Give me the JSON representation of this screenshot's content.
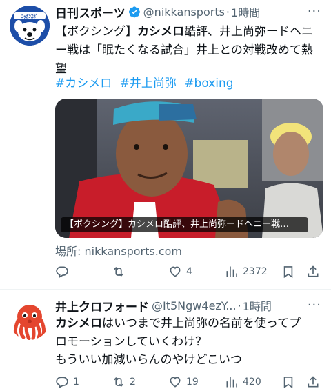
{
  "tweet1": {
    "display_name": "日刊スポーツ",
    "verified": true,
    "handle": "@nikkansports",
    "separator": "·",
    "time": "1時間",
    "more": "···",
    "avatar_icon": "nikkan-mascot-avatar",
    "text_parts": [
      "【ボクシング】",
      "カシメロ",
      "酷評、井上尚弥ードヘ",
      "ニー戦は「眠たくなる試合」井上との対戦改めて熱望"
    ],
    "hashtags": [
      "#カシメロ",
      "#井上尚弥",
      "#boxing"
    ],
    "card": {
      "caption": "【ボクシング】カシメロ酷評、井上尚弥ードヘニー戦…"
    },
    "source": "場所: nikkansports.com",
    "stats": {
      "replies": "",
      "retweets": "",
      "likes": "4",
      "views": "2372"
    }
  },
  "tweet2": {
    "display_name": "井上クロフォード",
    "handle": "@It5Ngw4ezY...",
    "separator": "·",
    "time": "1時間",
    "more": "···",
    "avatar_icon": "red-octopus-avatar",
    "text_parts": [
      "カシメロ",
      "はいつまで井上尚弥の名前を使ってプ",
      "ロモーションしていくわけ？",
      "もういい加減いらんのやけどこいつ"
    ],
    "stats": {
      "replies": "1",
      "retweets": "2",
      "likes": "19",
      "views": "420"
    }
  },
  "colors": {
    "text": "#0f1419",
    "secondary": "#536471",
    "link": "#1d9bf0",
    "verified": "#1d9bf0",
    "divider": "#eff3f4"
  }
}
